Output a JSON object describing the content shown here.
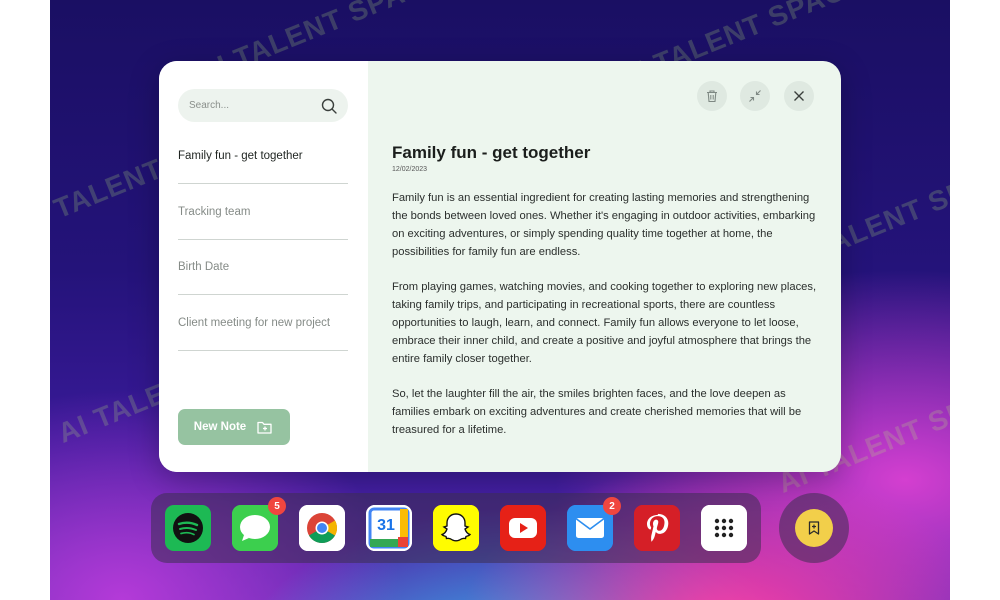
{
  "watermark": {
    "text": "AI TALENT SPACE"
  },
  "sidebar": {
    "search_placeholder": "Search...",
    "notes": [
      {
        "label": "Family fun - get together",
        "active": true
      },
      {
        "label": "Tracking team",
        "active": false
      },
      {
        "label": "Birth Date",
        "active": false
      },
      {
        "label": "Client meeting for new project",
        "active": false
      }
    ],
    "new_note_label": "New Note"
  },
  "toolbar": {
    "icons": [
      "trash-icon",
      "collapse-icon",
      "close-icon"
    ]
  },
  "note": {
    "title": "Family fun - get together",
    "date": "12/02/2023",
    "paragraphs": [
      "Family fun is an essential ingredient for creating lasting memories and strengthening the bonds between loved ones. Whether it's engaging in outdoor activities, embarking on exciting adventures, or simply spending quality time together at home, the possibilities for family fun are endless.",
      "From playing games, watching movies, and cooking together to exploring new places, taking family trips, and participating in recreational sports, there are countless opportunities to laugh, learn, and connect. Family fun allows everyone to let loose, embrace their inner child, and create a positive and joyful atmosphere that brings the entire family closer together.",
      "So, let the laughter fill the air, the smiles brighten faces, and the love deepen as families embark on exciting adventures and create cherished memories that will be treasured for a lifetime."
    ]
  },
  "dock": {
    "apps": [
      {
        "name": "spotify",
        "badge": ""
      },
      {
        "name": "messages",
        "badge": "5"
      },
      {
        "name": "chrome",
        "badge": ""
      },
      {
        "name": "calendar",
        "badge": "",
        "day": "31"
      },
      {
        "name": "snapchat",
        "badge": ""
      },
      {
        "name": "youtube",
        "badge": ""
      },
      {
        "name": "mail",
        "badge": "2"
      },
      {
        "name": "pinterest",
        "badge": ""
      },
      {
        "name": "app-grid",
        "badge": ""
      }
    ]
  },
  "colors": {
    "accent_green": "#96c3a1",
    "badge_red": "#f0463f",
    "quick_note_yellow": "#f2cf4a"
  }
}
